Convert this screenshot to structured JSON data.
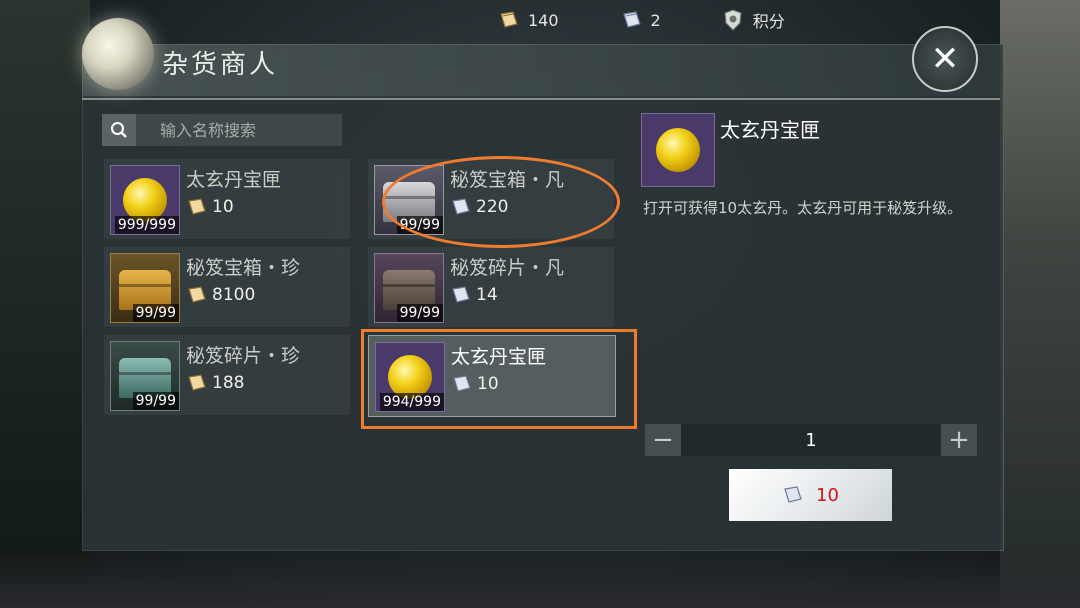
{
  "currency": {
    "book_count": "140",
    "silver_book_count": "2",
    "points_label": "积分"
  },
  "panel": {
    "title": "杂货商人",
    "close_symbol": "✕"
  },
  "search": {
    "placeholder": "输入名称搜索"
  },
  "items": [
    {
      "name": "太玄丹宝匣",
      "price": "10",
      "count": "999/999",
      "icon": "golden-orb"
    },
    {
      "name": "秘笈宝箱・凡",
      "price": "220",
      "count": "99/99",
      "icon": "silver-chest"
    },
    {
      "name": "秘笈宝箱・珍",
      "price": "8100",
      "count": "99/99",
      "icon": "gold-chest"
    },
    {
      "name": "秘笈碎片・凡",
      "price": "14",
      "count": "99/99",
      "icon": "brown-chest"
    },
    {
      "name": "秘笈碎片・珍",
      "price": "188",
      "count": "99/99",
      "icon": "teal-chest"
    },
    {
      "name": "太玄丹宝匣",
      "price": "10",
      "count": "994/999",
      "icon": "golden-orb"
    }
  ],
  "detail": {
    "name": "太玄丹宝匣",
    "description": "打开可获得10太玄丹。太玄丹可用于秘笈升级。",
    "quantity": "1",
    "minus": "−",
    "plus": "+",
    "buy_price": "10"
  },
  "colors": {
    "annotation": "#ef7c2e",
    "price_red": "#d2141a"
  }
}
